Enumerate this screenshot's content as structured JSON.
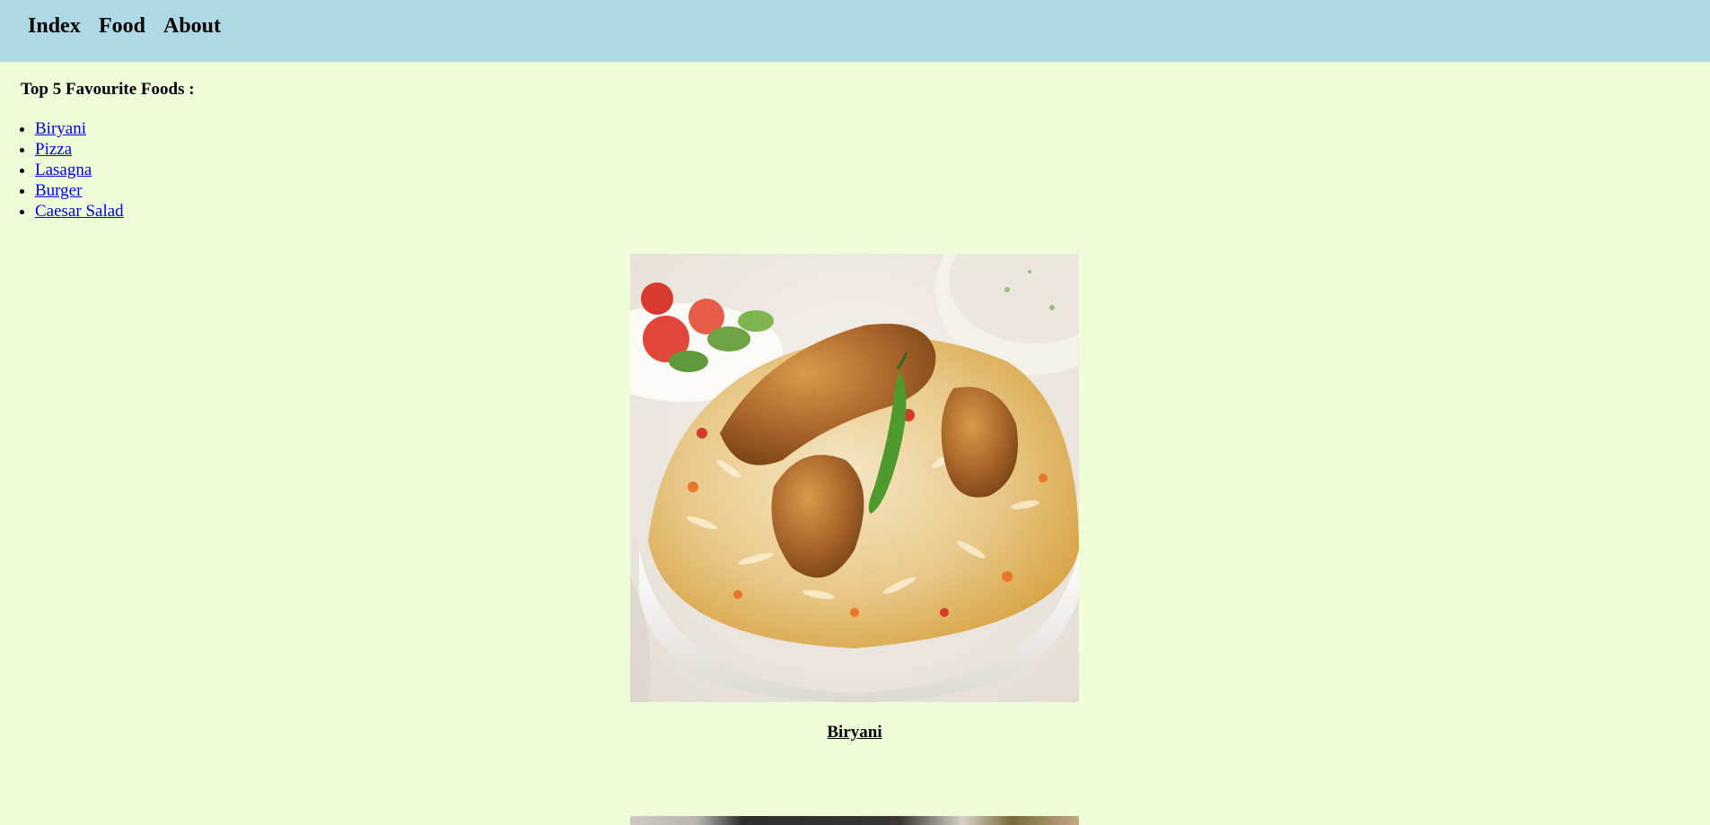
{
  "nav": {
    "items": [
      {
        "label": "Index"
      },
      {
        "label": "Food"
      },
      {
        "label": "About"
      }
    ]
  },
  "main": {
    "heading": "Top 5 Favourite Foods :",
    "foods": [
      {
        "label": "Biryani"
      },
      {
        "label": "Pizza"
      },
      {
        "label": "Lasagna"
      },
      {
        "label": "Burger"
      },
      {
        "label": "Caesar Salad"
      }
    ],
    "featured_caption": "Biryani"
  },
  "colors": {
    "nav_background": "#add8e6",
    "page_background": "#eefcd8",
    "link": "#0000ee"
  }
}
